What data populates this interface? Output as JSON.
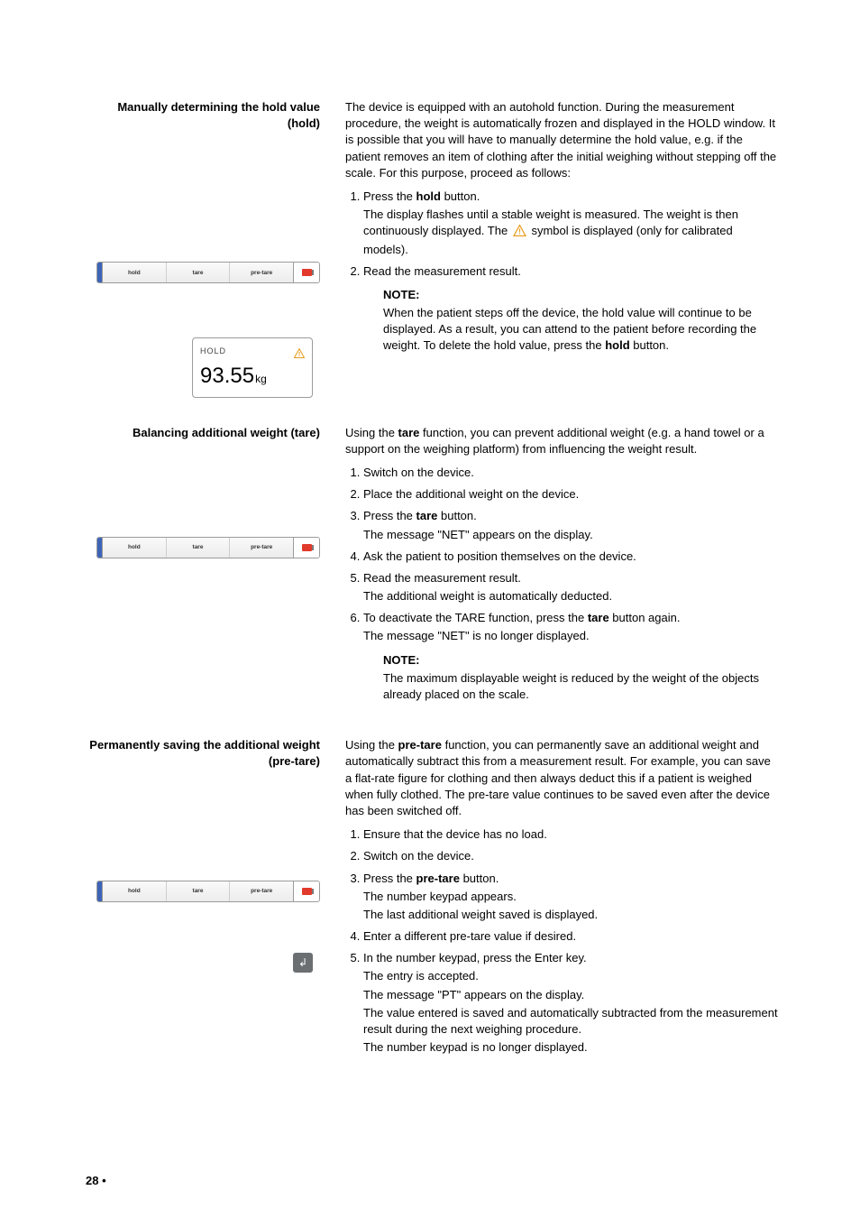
{
  "page_number": "28 •",
  "device_bar": {
    "buttons": [
      "hold",
      "tare",
      "pre-tare"
    ]
  },
  "hold_display": {
    "label": "HOLD",
    "value": "93.55",
    "unit": "kg"
  },
  "sec1": {
    "heading": "Manually determining the hold value (hold)",
    "intro": "The device is equipped with an autohold function. During the measurement procedure, the weight is automatically frozen and displayed in the HOLD window. It is possible that you will have to manually determine the hold value, e.g. if the patient removes an item of clothing after the initial weighing without stepping off the scale. For this purpose, proceed as follows:",
    "step1_a": "Press the ",
    "step1_bold": "hold",
    "step1_b": " button.",
    "step1_sub_a": "The display flashes until a stable weight is measured. The weight is then continuously displayed. The ",
    "step1_sub_b": " symbol is displayed (only for calibrated models).",
    "step2": "Read the measurement result.",
    "note_label": "NOTE:",
    "note_a": "When the patient steps off the device, the hold value will continue to be displayed. As a result, you can attend to the patient before recording the weight. To delete the hold value, press the ",
    "note_bold": "hold",
    "note_b": " button."
  },
  "sec2": {
    "heading": "Balancing additional weight (tare)",
    "intro_a": "Using the ",
    "intro_bold": "tare",
    "intro_b": " function, you can prevent additional weight (e.g. a hand towel or a support on the weighing platform) from influencing the weight result.",
    "step1": "Switch on the device.",
    "step2": "Place the additional weight on the device.",
    "step3_a": "Press the ",
    "step3_bold": "tare",
    "step3_b": " button.",
    "step3_sub": "The message \"NET\" appears on the display.",
    "step4": "Ask the patient to position themselves on the device.",
    "step5": "Read the measurement result.",
    "step5_sub": "The additional weight is automatically deducted.",
    "step6_a": "To deactivate the TARE function, press the ",
    "step6_bold": "tare",
    "step6_b": " button again.",
    "step6_sub": "The message \"NET\" is no longer displayed.",
    "note_label": "NOTE:",
    "note_text": "The maximum displayable weight is reduced by the weight of the objects already placed on the scale."
  },
  "sec3": {
    "heading": "Permanently saving the additional weight (pre-tare)",
    "intro_a": "Using the ",
    "intro_bold": "pre-tare",
    "intro_b": " function, you can permanently save an additional weight and automatically subtract this from a measurement result. For example, you can save a flat-rate figure for clothing and then always deduct this if a patient is weighed when fully clothed. The pre-tare value continues to be saved even after the device has been switched off.",
    "step1": "Ensure that the device has no load.",
    "step2": "Switch on the device.",
    "step3_a": "Press the ",
    "step3_bold": "pre-tare",
    "step3_b": " button.",
    "step3_sub1": "The number keypad appears.",
    "step3_sub2": "The last additional weight saved is displayed.",
    "step4": "Enter a different pre-tare value if desired.",
    "step5": "In the number keypad, press the Enter key.",
    "step5_sub1": "The entry is accepted.",
    "step5_sub2": "The message \"PT\" appears on the display.",
    "step5_sub3": "The value entered is saved and automatically subtracted from the measurement result during the next weighing procedure.",
    "step5_sub4": "The number keypad is no longer displayed."
  }
}
